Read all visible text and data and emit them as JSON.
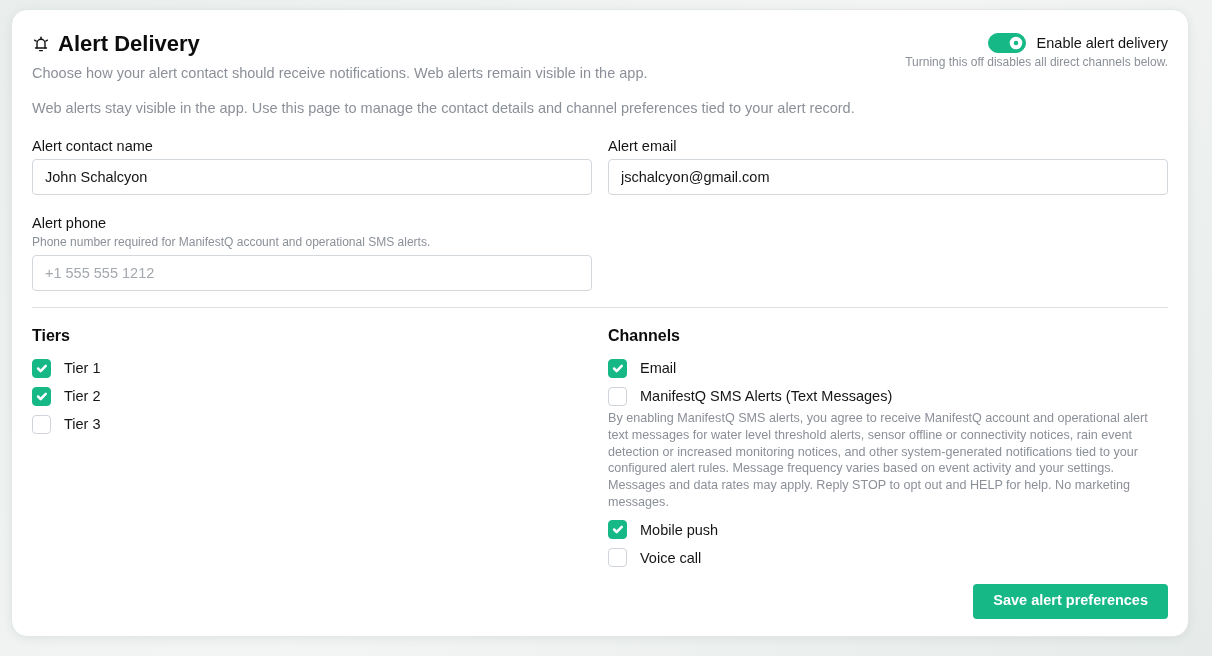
{
  "header": {
    "title": "Alert Delivery",
    "subtitle": "Choose how your alert contact should receive notifications. Web alerts remain visible in the app.",
    "toggle": {
      "label": "Enable alert delivery",
      "on": true,
      "hint": "Turning this off disables all direct channels below."
    }
  },
  "intro": "Web alerts stay visible in the app. Use this page to manage the contact details and channel preferences tied to your alert record.",
  "fields": [
    {
      "label": "Alert contact name",
      "value": "John Schalcyon"
    },
    {
      "label": "Alert email",
      "value": "jschalcyon@gmail.com"
    },
    {
      "label": "Alert phone",
      "hint": "Phone number required for ManifestQ account and operational SMS alerts.",
      "placeholder": "+1 555 555 1212"
    }
  ],
  "tiers": {
    "title": "Tiers",
    "items": [
      {
        "label": "Tier 1",
        "checked": true
      },
      {
        "label": "Tier 2",
        "checked": true
      },
      {
        "label": "Tier 3",
        "checked": false
      }
    ]
  },
  "channels": {
    "title": "Channels",
    "items": [
      {
        "label": "Email",
        "checked": true
      },
      {
        "label": "ManifestQ SMS Alerts (Text Messages)",
        "checked": false,
        "note": "By enabling ManifestQ SMS alerts, you agree to receive ManifestQ account and operational alert text messages for water level threshold alerts, sensor offline or connectivity notices, rain event detection or increased monitoring notices, and other system-generated notifications tied to your configured alert rules. Message frequency varies based on event activity and your settings. Messages and data rates may apply. Reply STOP to opt out and HELP for help. No marketing messages."
      },
      {
        "label": "Mobile push",
        "checked": true
      },
      {
        "label": "Voice call",
        "checked": false
      }
    ]
  },
  "save_button": "Save alert preferences"
}
